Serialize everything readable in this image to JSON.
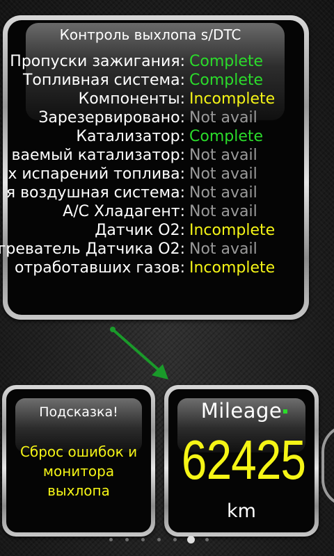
{
  "status_panel": {
    "title": "Контроль выхлопа s/DTC",
    "rows": [
      {
        "label": "Пропуски зажигания:",
        "value": "Complete",
        "status": "complete"
      },
      {
        "label": "Топливная система:",
        "value": "Complete",
        "status": "complete"
      },
      {
        "label": "Компоненты:",
        "value": "Incomplete",
        "status": "incomplete"
      },
      {
        "label": "Зарезервировано:",
        "value": "Not avail",
        "status": "na"
      },
      {
        "label": "Катализатор:",
        "value": "Complete",
        "status": "complete"
      },
      {
        "label": "ваемый катализатор:",
        "value": "Not avail",
        "status": "na"
      },
      {
        "label": "х испарений топлива:",
        "value": "Not avail",
        "status": "na"
      },
      {
        "label": "я воздушная система:",
        "value": "Not avail",
        "status": "na"
      },
      {
        "label": "A/C Хладагент:",
        "value": "Not avail",
        "status": "na"
      },
      {
        "label": "Датчик O2:",
        "value": "Incomplete",
        "status": "incomplete"
      },
      {
        "label": "греватель Датчика O2:",
        "value": "Not avail",
        "status": "na"
      },
      {
        "label": "отработавших газов:",
        "value": "Incomplete",
        "status": "incomplete"
      }
    ]
  },
  "hint_panel": {
    "title": "Подсказка!",
    "text": "Сброс ошибок и монитора выхлопа"
  },
  "mileage_panel": {
    "title": "Mileage",
    "value": "62425",
    "unit": "km"
  },
  "pager": {
    "count": 7,
    "active_index": 5
  },
  "colors": {
    "complete": "#2bdc2b",
    "incomplete": "#f5f516",
    "not_available": "#9a9a9a",
    "arrow": "#1a9a2a"
  },
  "icons": {
    "arrow": "arrow-down-right-icon"
  }
}
